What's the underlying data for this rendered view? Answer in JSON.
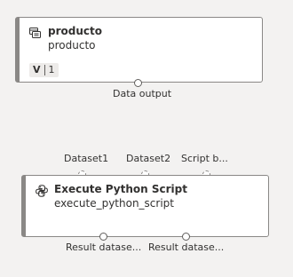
{
  "canvas": {
    "background": "#f3f2f1"
  },
  "nodes": {
    "producto": {
      "icon": "dataset-icon",
      "title": "producto",
      "subtitle": "producto",
      "version_prefix": "V",
      "version": "1",
      "output_ports": [
        {
          "label": "Data output"
        }
      ]
    },
    "python": {
      "icon": "python-icon",
      "title": "Execute Python Script",
      "subtitle": "execute_python_script",
      "input_ports": [
        {
          "label": "Dataset1"
        },
        {
          "label": "Dataset2"
        },
        {
          "label": "Script b..."
        }
      ],
      "output_ports": [
        {
          "label": "Result datase..."
        },
        {
          "label": "Result datase..."
        }
      ]
    }
  },
  "colors": {
    "node_border": "#8a8886",
    "node_background": "#ffffff",
    "text": "#323130"
  }
}
